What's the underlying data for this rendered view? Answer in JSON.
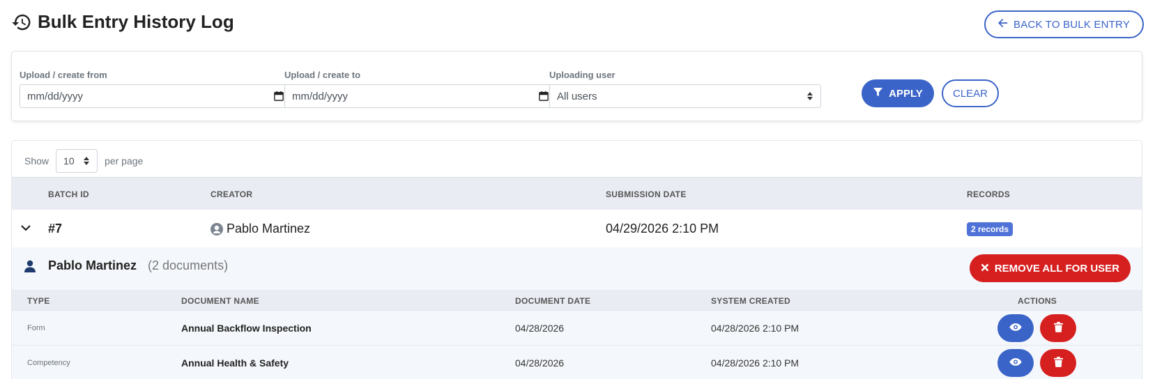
{
  "header": {
    "title": "Bulk Entry History Log",
    "back_label": "BACK TO BULK ENTRY"
  },
  "filters": {
    "from_label": "Upload / create from",
    "from_placeholder": "mm/dd/yyyy",
    "to_label": "Upload / create to",
    "to_placeholder": "mm/dd/yyyy",
    "user_label": "Uploading user",
    "user_value": "All users",
    "apply_label": "APPLY",
    "clear_label": "CLEAR"
  },
  "table": {
    "show_label": "Show",
    "per_page_value": "10",
    "per_page_label": "per page",
    "columns": {
      "batch_id": "BATCH ID",
      "creator": "CREATOR",
      "submission_date": "SUBMISSION DATE",
      "records": "RECORDS"
    },
    "batch": {
      "id": "#7",
      "creator": "Pablo Martinez",
      "submission_date": "04/29/2026 2:10 PM",
      "records": "2 records"
    }
  },
  "detail": {
    "user_name": "Pablo Martinez",
    "doc_count": "(2 documents)",
    "remove_all_label": "REMOVE ALL FOR USER",
    "columns": {
      "type": "TYPE",
      "document_name": "DOCUMENT NAME",
      "document_date": "DOCUMENT DATE",
      "system_created": "SYSTEM CREATED",
      "actions": "ACTIONS"
    },
    "rows": [
      {
        "type": "Form",
        "name": "Annual Backflow Inspection",
        "doc_date": "04/28/2026",
        "sys_created": "04/28/2026 2:10 PM"
      },
      {
        "type": "Competency",
        "name": "Annual Health & Safety",
        "doc_date": "04/28/2026",
        "sys_created": "04/28/2026 2:10 PM"
      }
    ]
  },
  "colors": {
    "primary": "#3a64c8",
    "danger": "#d61f1f",
    "badge": "#4f72d8",
    "header_bg": "#e9ecf2"
  }
}
